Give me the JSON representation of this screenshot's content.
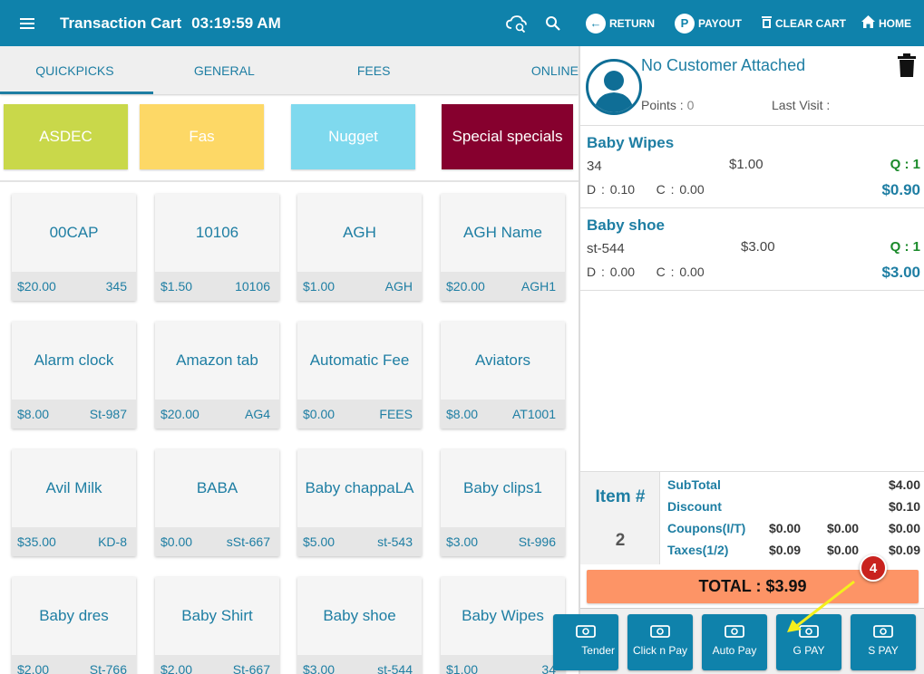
{
  "header": {
    "title": "Transaction Cart",
    "time": "03:19:59 AM",
    "actions": {
      "return": "RETURN",
      "payout": "PAYOUT",
      "clear_cart": "CLEAR CART",
      "home": "HOME"
    },
    "payout_letter": "P",
    "return_glyph": "←"
  },
  "tabs": [
    "QUICKPICKS",
    "GENERAL",
    "FEES",
    "ONLINE"
  ],
  "categories": [
    {
      "label": "ASDEC",
      "color": "#c9d84a"
    },
    {
      "label": "Fas",
      "color": "#fdd866"
    },
    {
      "label": "Nugget",
      "color": "#7fd9ee"
    },
    {
      "label": "Special specials",
      "color": "#86002e"
    }
  ],
  "products": [
    {
      "name": "00CAP",
      "price": "$20.00",
      "code": "345"
    },
    {
      "name": "10106",
      "price": "$1.50",
      "code": "10106"
    },
    {
      "name": "AGH",
      "price": "$1.00",
      "code": "AGH"
    },
    {
      "name": "AGH Name",
      "price": "$20.00",
      "code": "AGH1"
    },
    {
      "name": "Alarm clock",
      "price": "$8.00",
      "code": "St-987"
    },
    {
      "name": "Amazon tab",
      "price": "$20.00",
      "code": "AG4"
    },
    {
      "name": "Automatic Fee",
      "price": "$0.00",
      "code": "FEES"
    },
    {
      "name": "Aviators",
      "price": "$8.00",
      "code": "AT1001"
    },
    {
      "name": "Avil Milk",
      "price": "$35.00",
      "code": "KD-8"
    },
    {
      "name": "BABA",
      "price": "$0.00",
      "code": "sSt-667"
    },
    {
      "name": "Baby chappaLA",
      "price": "$5.00",
      "code": "st-543"
    },
    {
      "name": "Baby clips1",
      "price": "$3.00",
      "code": "St-996"
    },
    {
      "name": "Baby dres",
      "price": "$2.00",
      "code": "St-766"
    },
    {
      "name": "Baby Shirt",
      "price": "$2.00",
      "code": "St-667"
    },
    {
      "name": "Baby shoe",
      "price": "$3.00",
      "code": "st-544"
    },
    {
      "name": "Baby Wipes",
      "price": "$1.00",
      "code": "34"
    }
  ],
  "customer": {
    "name": "No Customer Attached",
    "points_label": "Points :",
    "points_value": "0",
    "last_visit_label": "Last Visit :"
  },
  "cart": [
    {
      "name": "Baby Wipes",
      "sku": "34",
      "price": "$1.00",
      "qty": "Q : 1",
      "discount": "D : 0.10",
      "coupon": "C : 0.00",
      "amount": "$0.90"
    },
    {
      "name": "Baby shoe",
      "sku": "st-544",
      "price": "$3.00",
      "qty": "Q : 1",
      "discount": "D : 0.00",
      "coupon": "C : 0.00",
      "amount": "$3.00"
    }
  ],
  "summary": {
    "item_label": "Item #",
    "item_count": "2",
    "subtotal_label": "SubTotal",
    "subtotal": "$4.00",
    "discount_label": "Discount",
    "discount": "$0.10",
    "coupons_label": "Coupons(I/T)",
    "coupons": [
      "$0.00",
      "$0.00",
      "$0.00"
    ],
    "taxes_label": "Taxes(1/2)",
    "taxes": [
      "$0.09",
      "$0.00",
      "$0.09"
    ]
  },
  "total": "TOTAL : $3.99",
  "pay_buttons": [
    "Tender",
    "Click n Pay",
    "Auto Pay",
    "G PAY",
    "S PAY"
  ],
  "callout_number": "4",
  "colors": {
    "header": "#0f82ab",
    "accent": "#1e7ea3",
    "total_bg": "#fd9466",
    "qty_green": "#1a8a2a",
    "callout_red": "#c9221e",
    "arrow_yellow": "#f4f01c"
  }
}
